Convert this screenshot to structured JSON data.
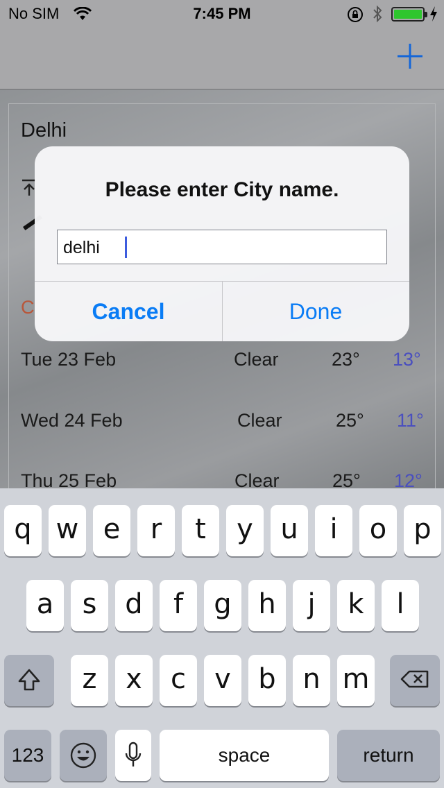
{
  "status_bar": {
    "carrier": "No SIM",
    "time": "7:45 PM",
    "icons": [
      "wifi-icon",
      "rotation-lock-icon",
      "bluetooth-icon",
      "battery-icon",
      "charging-bolt-icon"
    ]
  },
  "nav": {
    "add_icon": "plus-icon"
  },
  "weather": {
    "city": "Delhi",
    "partial_label": "C",
    "forecast": [
      {
        "day": "Tue 23 Feb",
        "condition": "Clear",
        "high": "23°",
        "low": "13°"
      },
      {
        "day": "Wed 24 Feb",
        "condition": "Clear",
        "high": "25°",
        "low": "11°"
      },
      {
        "day": "Thu 25 Feb",
        "condition": "Clear",
        "high": "25°",
        "low": "12°"
      }
    ]
  },
  "alert": {
    "title": "Please enter City name.",
    "input_value": "delhi",
    "cancel_label": "Cancel",
    "done_label": "Done"
  },
  "keyboard": {
    "row1": [
      "q",
      "w",
      "e",
      "r",
      "t",
      "y",
      "u",
      "i",
      "o",
      "p"
    ],
    "row2": [
      "a",
      "s",
      "d",
      "f",
      "g",
      "h",
      "j",
      "k",
      "l"
    ],
    "row3": [
      "z",
      "x",
      "c",
      "v",
      "b",
      "n",
      "m"
    ],
    "numbers_label": "123",
    "space_label": "space",
    "return_label": "return",
    "icons": [
      "shift-icon",
      "backspace-icon",
      "emoji-icon",
      "microphone-icon"
    ]
  },
  "colors": {
    "accent": "#0a7cf5",
    "low_temp": "#4a4fbf",
    "keyboard_bg": "#d0d3d9"
  }
}
